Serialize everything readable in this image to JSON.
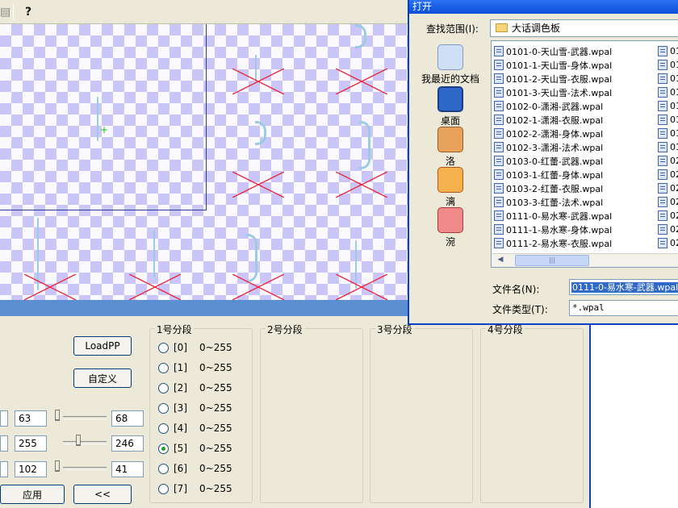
{
  "toolbar": {
    "help_icon": "question-icon"
  },
  "load_pp_button": "LoadPP",
  "custom_button": "自定义",
  "apply_button": "应用",
  "back_button": "<<",
  "values": {
    "row1": {
      "left": "63",
      "right": "68"
    },
    "row2": {
      "left": "255",
      "right": "246"
    },
    "row3": {
      "left": "102",
      "right": "41"
    }
  },
  "segments": {
    "group1_title": "1号分段",
    "group2_title": "2号分段",
    "group3_title": "3号分段",
    "group4_title": "4号分段",
    "options": [
      {
        "index": "[0]",
        "range": "0~255",
        "selected": false
      },
      {
        "index": "[1]",
        "range": "0~255",
        "selected": false
      },
      {
        "index": "[2]",
        "range": "0~255",
        "selected": false
      },
      {
        "index": "[3]",
        "range": "0~255",
        "selected": false
      },
      {
        "index": "[4]",
        "range": "0~255",
        "selected": false
      },
      {
        "index": "[5]",
        "range": "0~255",
        "selected": true
      },
      {
        "index": "[6]",
        "range": "0~255",
        "selected": false
      },
      {
        "index": "[7]",
        "range": "0~255",
        "selected": false
      }
    ]
  },
  "dialog": {
    "title": "打开",
    "look_in_label": "查找范围(I):",
    "look_in_value": "大话调色板",
    "places": [
      {
        "label": "我最近的文档",
        "icon": "recent-documents-icon"
      },
      {
        "label": "桌面",
        "icon": "desktop-icon"
      },
      {
        "label": "洛",
        "icon": "scroll-icon"
      },
      {
        "label": "漓",
        "icon": "character-icon"
      },
      {
        "label": "涴",
        "icon": "character-icon"
      }
    ],
    "files": [
      "0101-0-天山雪-武器.wpal",
      "0101-1-天山雪-身体.wpal",
      "0101-2-天山雪-衣服.wpal",
      "0101-3-天山雪-法术.wpal",
      "0102-0-潇湘-武器.wpal",
      "0102-1-潇湘-衣服.wpal",
      "0102-2-潇湘-身体.wpal",
      "0102-3-潇湘-法术.wpal",
      "0103-0-红蕾-武器.wpal",
      "0103-1-红蕾-身体.wpal",
      "0103-2-红蕾-衣服.wpal",
      "0103-3-红蕾-法术.wpal",
      "0111-0-易水寒-武器.wpal",
      "0111-1-易水寒-身体.wpal",
      "0111-2-易水寒-衣服.wpal"
    ],
    "files_col2": [
      "01",
      "01",
      "01",
      "01",
      "01",
      "01",
      "01",
      "01",
      "02",
      "02",
      "02",
      "02",
      "02",
      "02",
      "02"
    ],
    "filename_label": "文件名(N):",
    "filename_value": "0111-0-易水寒-武器.wpal",
    "filetype_label": "文件类型(T):",
    "filetype_value": "*.wpal"
  }
}
